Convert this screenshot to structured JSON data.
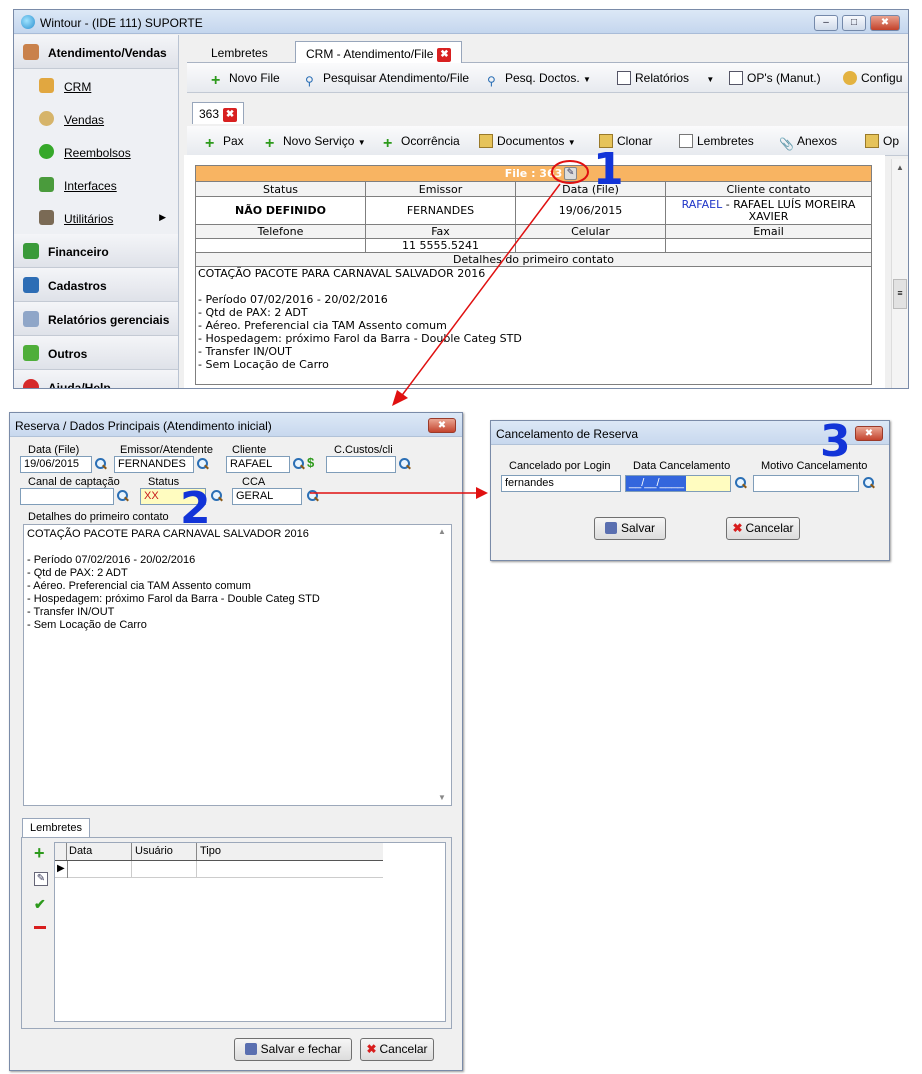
{
  "main_window": {
    "title": "Wintour - (IDE 111) SUPORTE",
    "sidebar": {
      "sections": [
        {
          "label": "Atendimento/Vendas",
          "icon": "user-icon"
        },
        {
          "label": "Financeiro",
          "icon": "money-icon"
        },
        {
          "label": "Cadastros",
          "icon": "book-icon"
        },
        {
          "label": "Relatórios gerenciais",
          "icon": "chart-icon"
        },
        {
          "label": "Outros",
          "icon": "puzzle-icon"
        },
        {
          "label": "Ajuda/Help",
          "icon": "help-icon"
        }
      ],
      "items": [
        {
          "label": "CRM",
          "icon": "crm-icon"
        },
        {
          "label": "Vendas",
          "icon": "sales-icon"
        },
        {
          "label": "Reembolsos",
          "icon": "refund-icon"
        },
        {
          "label": "Interfaces",
          "icon": "interfaces-icon"
        },
        {
          "label": "Utilitários",
          "icon": "tools-icon"
        }
      ]
    },
    "tabs": [
      {
        "label": "Lembretes"
      },
      {
        "label": "CRM - Atendimento/File"
      }
    ],
    "toolbar1": {
      "novo_file": "Novo File",
      "pesquisar": "Pesquisar Atendimento/File",
      "pesq_doctos": "Pesq. Doctos.",
      "relatorios": "Relatórios",
      "ops": "OP's (Manut.)",
      "config": "Configu"
    },
    "file_tab": "363",
    "toolbar2": {
      "pax": "Pax",
      "novo_servico": "Novo Serviço",
      "ocorrencia": "Ocorrência",
      "documentos": "Documentos",
      "clonar": "Clonar",
      "lembretes": "Lembretes",
      "anexos": "Anexos",
      "op": "Op"
    },
    "file_header": "File : 363",
    "grid": {
      "h_status": "Status",
      "h_emissor": "Emissor",
      "h_data": "Data (File)",
      "h_cliente": "Cliente contato",
      "v_status": "NÃO DEFINIDO",
      "v_emissor": "FERNANDES",
      "v_data": "19/06/2015",
      "v_cliente_link": "RAFAEL",
      "v_cliente_rest": " - RAFAEL LUÍS MOREIRA XAVIER",
      "h_telefone": "Telefone",
      "h_fax": "Fax",
      "h_celular": "Celular",
      "h_email": "Email",
      "v_fax": "11 5555.5241",
      "h_detalhes": "Detalhes do primeiro contato"
    },
    "detalhes": "COTAÇÃO PACOTE PARA CARNAVAL SALVADOR 2016\n\n- Período 07/02/2016 - 20/02/2016\n- Qtd de PAX: 2 ADT\n- Aéreo. Preferencial cia TAM Assento comum\n- Hospedagem: próximo Farol da Barra - Double Categ STD\n- Transfer IN/OUT\n- Sem Locação de Carro"
  },
  "reserva_dialog": {
    "title": "Reserva / Dados Principais (Atendimento inicial)",
    "labels": {
      "data_file": "Data (File)",
      "emissor": "Emissor/Atendente",
      "cliente": "Cliente",
      "ccustos": "C.Custos/cli",
      "canal": "Canal de captação",
      "status": "Status",
      "cca": "CCA",
      "detalhes": "Detalhes do primeiro contato"
    },
    "values": {
      "data_file": "19/06/2015",
      "emissor": "FERNANDES",
      "cliente": "RAFAEL",
      "ccustos": "",
      "canal": "",
      "status": "XX",
      "cca": "GERAL"
    },
    "detalhes": "COTAÇÃO PACOTE PARA CARNAVAL SALVADOR 2016\n\n- Período 07/02/2016 - 20/02/2016\n- Qtd de PAX: 2 ADT\n- Aéreo. Preferencial cia TAM Assento comum\n- Hospedagem: próximo Farol da Barra - Double Categ STD\n- Transfer IN/OUT\n- Sem Locação de Carro",
    "lembretes_tab": "Lembretes",
    "cols": {
      "data": "Data",
      "usuario": "Usuário",
      "tipo": "Tipo"
    },
    "save_close": "Salvar e fechar",
    "cancel": "Cancelar"
  },
  "cancel_dialog": {
    "title": "Cancelamento de Reserva",
    "labels": {
      "login": "Cancelado por Login",
      "data": "Data Cancelamento",
      "motivo": "Motivo Cancelamento"
    },
    "values": {
      "login": "fernandes",
      "data": "__/__/____",
      "motivo": ""
    },
    "save": "Salvar",
    "cancel": "Cancelar"
  },
  "annotations": {
    "n1": "1",
    "n2": "2",
    "n3": "3"
  }
}
